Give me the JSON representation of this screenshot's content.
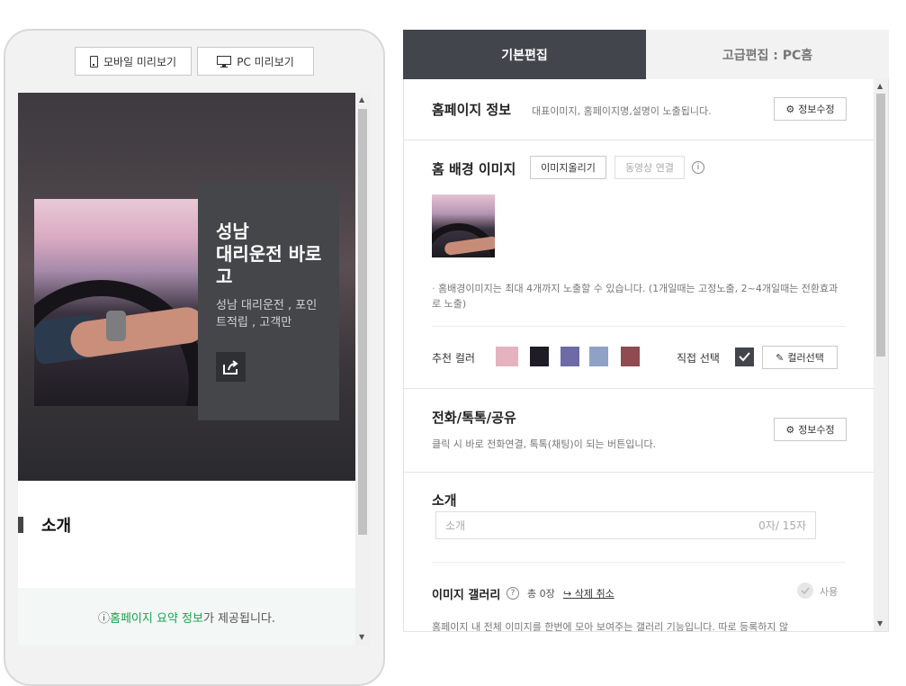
{
  "preview": {
    "mobile_label": "모바일 미리보기",
    "pc_label": "PC 미리보기"
  },
  "phone": {
    "hero_title": "성남\n대리운전 바로고",
    "hero_subtitle": "성남 대리운전 , 포인트적립 , 고객만",
    "intro_title": "소개",
    "notice_prefix": "ⓘ",
    "notice_green": "홈페이지 요약 정보",
    "notice_suffix": "가 제공됩니다."
  },
  "tabs": [
    {
      "label": "기본편집",
      "active": true
    },
    {
      "label": "고급편집 : PC홈",
      "active": false
    }
  ],
  "sections": {
    "homepage_info": {
      "title": "홈페이지 정보",
      "desc": "대표이미지, 홈페이지명,설명이 노출됩니다.",
      "edit_label": "정보수정"
    },
    "background": {
      "title": "홈 배경 이미지",
      "upload_label": "이미지올리기",
      "video_label": "동영상 연결",
      "note": "홈배경이미지는 최대 4개까지 노출할 수 있습니다. (1개일때는 고정노출, 2~4개일때는 전환효과로 노출)",
      "recommend_label": "추천 컬러",
      "direct_label": "직접 선택",
      "color_pick_label": "컬러선택",
      "swatches": [
        "#e5b3c0",
        "#1f1c26",
        "#6e6aa6",
        "#8fa1c6",
        "#8f4a52"
      ]
    },
    "contact": {
      "title": "전화/톡톡/공유",
      "desc": "클릭 시 바로 전화연결, 톡톡(채팅)이 되는 버튼입니다.",
      "edit_label": "정보수정"
    },
    "intro": {
      "title": "소개",
      "placeholder": "소개",
      "counter": "0자/ 15자"
    },
    "gallery": {
      "title": "이미지 갤러리",
      "count": "총 0장",
      "undo_label": "삭제 취소",
      "use_label": "사용",
      "desc": "홈페이지 내 전체 이미지를 한번에 모아 보여주는 갤러리 기능입니다. 따로 등록하지 않"
    }
  }
}
